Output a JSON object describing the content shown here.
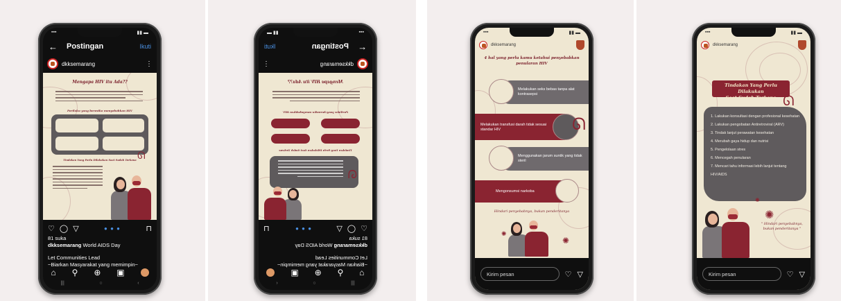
{
  "instagram": {
    "header_title": "Postingan",
    "follow_label": "Ikuti",
    "username": "dkksemarang",
    "likes": "81 suka",
    "caption_user": "dkksemarang",
    "caption_text": "World AIDS Day",
    "caption_line2": "Let Communities Lead",
    "caption_line3": "~Biarkan Masyarakat yang memimpin~"
  },
  "poster1": {
    "title": "Mengapa HIV itu Ada??",
    "subtitle": "Perilaku yang beresiko menyebabkan HIV",
    "section2_title": "Tindakan Yang Perlu Dilakukan Saat Sudah Terkena"
  },
  "story1": {
    "username": "dkksemarang",
    "title_line1": "4 hal yang perlu kamu ketahui penyebabkan",
    "title_line2": "penularan HIV",
    "items": [
      "Melakukan seks bebas tanpa alat kontrasepsi",
      "Melakukan transfusi darah tidak sesuai standar HIV",
      "Menggunakan jarum suntik yang tidak steril",
      "Mengonsumsi narkoba"
    ],
    "quote": "Hindari penyebabnya, bukan penderitanya",
    "reply_placeholder": "Kirim pesan"
  },
  "story2": {
    "username": "dkksemarang",
    "banner_line1": "Tindakan Yang Perlu Dilakukan",
    "banner_line2": "Saat Sudah Terkena",
    "items": [
      "1. Lakukan konsultasi dengan profesional kesehatan",
      "2. Lakukan pengobatan Antiretroviral (ARV)",
      "3. Tindak lanjut perawatan kesehatan",
      "4. Merubah gaya hidup dan nutrisi",
      "5. Pengelolaan stres",
      "6. Mencegah penularan",
      "7. Mencari tahu informasi lebih lanjut tentang HIV/AIDS"
    ],
    "quote": "\" Hindari penyebabnya, bukan penderitanya \"",
    "reply_placeholder": "Kirim pesan"
  },
  "icons": {
    "heart": "♡",
    "comment": "◯",
    "send": "▽",
    "save": "⊓",
    "home": "⌂",
    "search": "⚲",
    "add": "⊕",
    "reels": "▣",
    "back": "←",
    "menu": "⋮"
  },
  "colors": {
    "maroon": "#8a2431",
    "cream": "#efe7d2",
    "grey": "#5e5a5c",
    "link": "#4a90e2"
  }
}
